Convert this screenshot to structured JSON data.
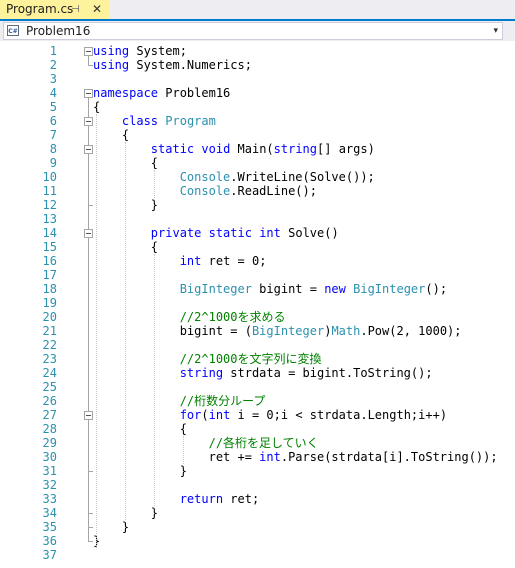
{
  "tab": {
    "title": "Program.cs",
    "pin_glyph": "⊣",
    "close_glyph": "✕"
  },
  "navbar": {
    "icon_label": "C#",
    "scope": "Problem16",
    "dropdown_glyph": "▾"
  },
  "colors": {
    "keyword": "#0000ff",
    "type": "#2b91af",
    "comment": "#008000",
    "text": "#000000",
    "line_number": "#2b91af",
    "tab_active": "#fff29d",
    "accent": "#007acc"
  },
  "lines": [
    {
      "n": "1",
      "tokens": [
        {
          "t": "kw",
          "v": "using"
        },
        {
          "t": "tx",
          "v": " System;"
        }
      ]
    },
    {
      "n": "2",
      "tokens": [
        {
          "t": "kw",
          "v": "using"
        },
        {
          "t": "tx",
          "v": " System.Numerics;"
        }
      ]
    },
    {
      "n": "3",
      "tokens": []
    },
    {
      "n": "4",
      "tokens": [
        {
          "t": "kw",
          "v": "namespace"
        },
        {
          "t": "tx",
          "v": " Problem16"
        }
      ]
    },
    {
      "n": "5",
      "tokens": [
        {
          "t": "tx",
          "v": "{"
        }
      ]
    },
    {
      "n": "6",
      "tokens": [
        {
          "t": "tx",
          "v": "    "
        },
        {
          "t": "kw",
          "v": "class"
        },
        {
          "t": "tx",
          "v": " "
        },
        {
          "t": "ty",
          "v": "Program"
        }
      ]
    },
    {
      "n": "7",
      "tokens": [
        {
          "t": "tx",
          "v": "    {"
        }
      ]
    },
    {
      "n": "8",
      "tokens": [
        {
          "t": "tx",
          "v": "        "
        },
        {
          "t": "kw",
          "v": "static"
        },
        {
          "t": "tx",
          "v": " "
        },
        {
          "t": "kw",
          "v": "void"
        },
        {
          "t": "tx",
          "v": " Main("
        },
        {
          "t": "kw",
          "v": "string"
        },
        {
          "t": "tx",
          "v": "[] args)"
        }
      ]
    },
    {
      "n": "9",
      "tokens": [
        {
          "t": "tx",
          "v": "        {"
        }
      ]
    },
    {
      "n": "10",
      "tokens": [
        {
          "t": "tx",
          "v": "            "
        },
        {
          "t": "ty",
          "v": "Console"
        },
        {
          "t": "tx",
          "v": ".WriteLine(Solve());"
        }
      ]
    },
    {
      "n": "11",
      "tokens": [
        {
          "t": "tx",
          "v": "            "
        },
        {
          "t": "ty",
          "v": "Console"
        },
        {
          "t": "tx",
          "v": ".ReadLine();"
        }
      ]
    },
    {
      "n": "12",
      "tokens": [
        {
          "t": "tx",
          "v": "        }"
        }
      ]
    },
    {
      "n": "13",
      "tokens": []
    },
    {
      "n": "14",
      "tokens": [
        {
          "t": "tx",
          "v": "        "
        },
        {
          "t": "kw",
          "v": "private"
        },
        {
          "t": "tx",
          "v": " "
        },
        {
          "t": "kw",
          "v": "static"
        },
        {
          "t": "tx",
          "v": " "
        },
        {
          "t": "kw",
          "v": "int"
        },
        {
          "t": "tx",
          "v": " Solve()"
        }
      ]
    },
    {
      "n": "15",
      "tokens": [
        {
          "t": "tx",
          "v": "        {"
        }
      ]
    },
    {
      "n": "16",
      "tokens": [
        {
          "t": "tx",
          "v": "            "
        },
        {
          "t": "kw",
          "v": "int"
        },
        {
          "t": "tx",
          "v": " ret = 0;"
        }
      ]
    },
    {
      "n": "17",
      "tokens": []
    },
    {
      "n": "18",
      "tokens": [
        {
          "t": "tx",
          "v": "            "
        },
        {
          "t": "ty",
          "v": "BigInteger"
        },
        {
          "t": "tx",
          "v": " bigint = "
        },
        {
          "t": "kw",
          "v": "new"
        },
        {
          "t": "tx",
          "v": " "
        },
        {
          "t": "ty",
          "v": "BigInteger"
        },
        {
          "t": "tx",
          "v": "();"
        }
      ]
    },
    {
      "n": "19",
      "tokens": []
    },
    {
      "n": "20",
      "tokens": [
        {
          "t": "tx",
          "v": "            "
        },
        {
          "t": "cm",
          "v": "//2^1000を求める"
        }
      ]
    },
    {
      "n": "21",
      "tokens": [
        {
          "t": "tx",
          "v": "            bigint = ("
        },
        {
          "t": "ty",
          "v": "BigInteger"
        },
        {
          "t": "tx",
          "v": ")"
        },
        {
          "t": "ty",
          "v": "Math"
        },
        {
          "t": "tx",
          "v": ".Pow(2, 1000);"
        }
      ]
    },
    {
      "n": "22",
      "tokens": []
    },
    {
      "n": "23",
      "tokens": [
        {
          "t": "tx",
          "v": "            "
        },
        {
          "t": "cm",
          "v": "//2^1000を文字列に変換"
        }
      ]
    },
    {
      "n": "24",
      "tokens": [
        {
          "t": "tx",
          "v": "            "
        },
        {
          "t": "kw",
          "v": "string"
        },
        {
          "t": "tx",
          "v": " strdata = bigint.ToString();"
        }
      ]
    },
    {
      "n": "25",
      "tokens": []
    },
    {
      "n": "26",
      "tokens": [
        {
          "t": "tx",
          "v": "            "
        },
        {
          "t": "cm",
          "v": "//桁数分ループ"
        }
      ]
    },
    {
      "n": "27",
      "tokens": [
        {
          "t": "tx",
          "v": "            "
        },
        {
          "t": "kw",
          "v": "for"
        },
        {
          "t": "tx",
          "v": "("
        },
        {
          "t": "kw",
          "v": "int"
        },
        {
          "t": "tx",
          "v": " i = 0;i < strdata.Length;i++)"
        }
      ]
    },
    {
      "n": "28",
      "tokens": [
        {
          "t": "tx",
          "v": "            {"
        }
      ]
    },
    {
      "n": "29",
      "tokens": [
        {
          "t": "tx",
          "v": "                "
        },
        {
          "t": "cm",
          "v": "//各桁を足していく"
        }
      ]
    },
    {
      "n": "30",
      "tokens": [
        {
          "t": "tx",
          "v": "                ret += "
        },
        {
          "t": "kw",
          "v": "int"
        },
        {
          "t": "tx",
          "v": ".Parse(strdata[i].ToString());"
        }
      ]
    },
    {
      "n": "31",
      "tokens": [
        {
          "t": "tx",
          "v": "            }"
        }
      ]
    },
    {
      "n": "32",
      "tokens": []
    },
    {
      "n": "33",
      "tokens": [
        {
          "t": "tx",
          "v": "            "
        },
        {
          "t": "kw",
          "v": "return"
        },
        {
          "t": "tx",
          "v": " ret;"
        }
      ]
    },
    {
      "n": "34",
      "tokens": [
        {
          "t": "tx",
          "v": "        }"
        }
      ]
    },
    {
      "n": "35",
      "tokens": [
        {
          "t": "tx",
          "v": "    }"
        }
      ]
    },
    {
      "n": "36",
      "tokens": [
        {
          "t": "tx",
          "v": "}"
        }
      ]
    },
    {
      "n": "37",
      "tokens": []
    }
  ]
}
